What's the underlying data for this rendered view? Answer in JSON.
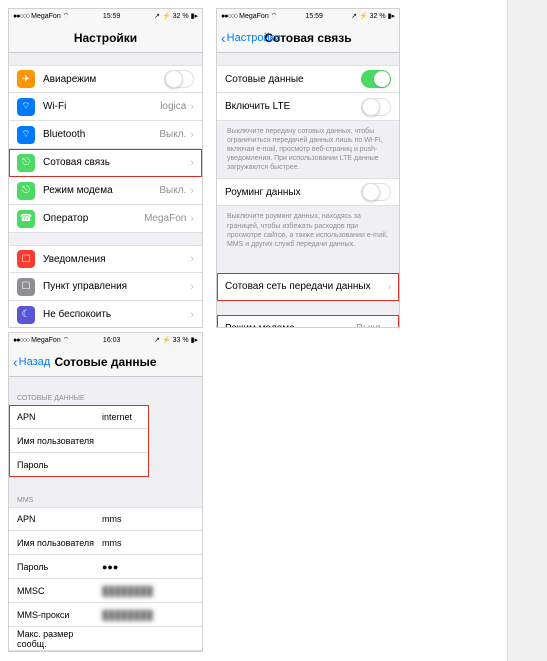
{
  "status": {
    "carrier": "MegaFon",
    "wifi": "⋮",
    "time1": "15:59",
    "time2": "16:03",
    "batt1": "32 %",
    "batt2": "33 %",
    "dots": "●●○○○"
  },
  "s1": {
    "title": "Настройки",
    "g1": [
      {
        "icon": "✈",
        "cls": "i-orange",
        "label": "Авиарежим",
        "type": "toggle",
        "on": false
      },
      {
        "icon": "⌔",
        "cls": "i-blue",
        "label": "Wi-Fi",
        "val": "logica",
        "type": "link"
      },
      {
        "icon": "⌔",
        "cls": "i-blue",
        "label": "Bluetooth",
        "val": "Выкл.",
        "type": "link"
      },
      {
        "icon": "⎋",
        "cls": "i-green",
        "label": "Сотовая связь",
        "type": "link",
        "hl": true
      },
      {
        "icon": "⎋",
        "cls": "i-green",
        "label": "Режим модема",
        "val": "Выкл.",
        "type": "link"
      },
      {
        "icon": "☎",
        "cls": "i-green",
        "label": "Оператор",
        "val": "MegaFon",
        "type": "link"
      }
    ],
    "g2": [
      {
        "icon": "☐",
        "cls": "i-red",
        "label": "Уведомления",
        "type": "link"
      },
      {
        "icon": "☐",
        "cls": "i-gray",
        "label": "Пункт управления",
        "type": "link"
      },
      {
        "icon": "☾",
        "cls": "i-purple",
        "label": "Не беспокоить",
        "type": "link"
      }
    ]
  },
  "s2": {
    "back": "Настройки",
    "title": "Сотовая связь",
    "g1": [
      {
        "label": "Сотовые данные",
        "type": "toggle",
        "on": true
      },
      {
        "label": "Включить LTE",
        "type": "toggle",
        "on": false
      }
    ],
    "note1": "Выключите передачу сотовых данных, чтобы ограничиться передачей данных лишь по Wi-Fi, включая e-mail, просмотр веб-страниц и push-уведомления. При использовании LTE данные загружаются быстрее.",
    "g2": [
      {
        "label": "Роуминг данных",
        "type": "toggle",
        "on": false
      }
    ],
    "note2": "Выключите роуминг данных, находясь за границей, чтобы избежать расходов при просмотре сайтов, а также использовании e-mail, MMS и других служб передачи данных.",
    "g3": [
      {
        "label": "Сотовая сеть передачи данных",
        "type": "link",
        "hl": true
      }
    ],
    "g4": [
      {
        "label": "Режим модема",
        "val": "Выкл.",
        "type": "link",
        "hl": true
      }
    ]
  },
  "s3": {
    "back": "Назад",
    "title": "Сотовые данные",
    "sect1": "СОТОВЫЕ ДАННЫЕ",
    "g1": [
      {
        "k": "APN",
        "v": "internet"
      },
      {
        "k": "Имя пользователя",
        "v": ""
      },
      {
        "k": "Пароль",
        "v": ""
      }
    ],
    "sect2": "MMS",
    "g2": [
      {
        "k": "APN",
        "v": "mms"
      },
      {
        "k": "Имя пользователя",
        "v": "mms"
      },
      {
        "k": "Пароль",
        "v": "●●●"
      },
      {
        "k": "MMSC",
        "v": "blurred",
        "blur": true
      },
      {
        "k": "MMS-прокси",
        "v": "blurred",
        "blur": true
      },
      {
        "k": "Макс. размер сообщ.",
        "v": ""
      }
    ]
  }
}
